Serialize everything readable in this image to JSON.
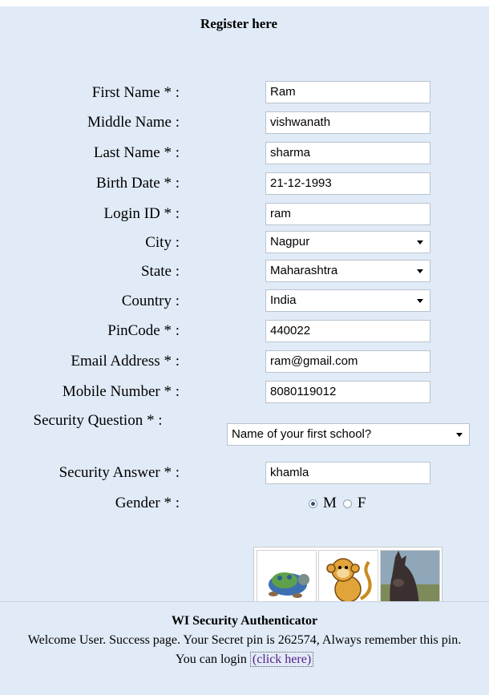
{
  "form": {
    "title": "Register here",
    "fields": [
      {
        "label": "First Name * :",
        "value": "Ram"
      },
      {
        "label": "Middle Name :",
        "value": "vishwanath"
      },
      {
        "label": "Last Name * :",
        "value": "sharma"
      },
      {
        "label": "Birth Date * :",
        "value": "21-12-1993"
      },
      {
        "label": "Login ID * :",
        "value": "ram"
      },
      {
        "label": "City :",
        "value": "Nagpur"
      },
      {
        "label": "State :",
        "value": "Maharashtra"
      },
      {
        "label": "Country :",
        "value": "India"
      },
      {
        "label": "PinCode * :",
        "value": "440022"
      },
      {
        "label": "Email Address * :",
        "value": "ram@gmail.com"
      },
      {
        "label": "Mobile Number * :",
        "value": "8080119012"
      },
      {
        "label": "Security Question * :",
        "value": "Name of your first school?"
      },
      {
        "label": "Security Answer * :",
        "value": "khamla"
      }
    ],
    "gender": {
      "label": "Gender * :",
      "options": [
        "M",
        "F"
      ],
      "selected": "M"
    },
    "captcha_icons": [
      "turtle-icon",
      "monkey-icon",
      "donkey-icon"
    ]
  },
  "footer": {
    "title": "WI Security Authenticator",
    "message": "Welcome User. Success page. Your Secret pin is 262574, Always remember this pin.",
    "login_prefix": "You can login",
    "login_link": "(click here)"
  },
  "colors": {
    "panel": "#e1ebf7",
    "link": "#551a8b"
  }
}
